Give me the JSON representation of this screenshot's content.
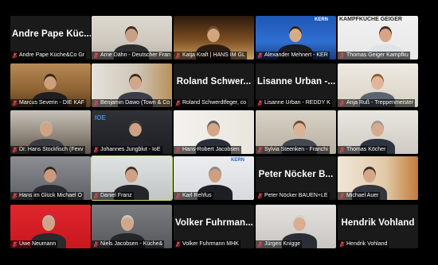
{
  "meeting": {
    "participants": [
      {
        "label": "Andre Pape Küche&Co Gr",
        "avatar_text": "Andre Pape Küc...",
        "video": false
      },
      {
        "label": "Arne Dähn - Deutscher Fran",
        "video": true
      },
      {
        "label": "Katja Kraft | HANS IM GL",
        "video": true
      },
      {
        "label": "Alexander Mehnert - KER",
        "video": true,
        "logo": "KERN"
      },
      {
        "label": "Thomas Geiger Kampfku",
        "video": true,
        "logo": "KAMPFKÜCHE GEIGER"
      },
      {
        "label": "Marcus Severin - DIE KAF",
        "video": true
      },
      {
        "label": "Benjamin Dawo (Town & Co",
        "video": true
      },
      {
        "label": "Roland Schwerdtfeger, co",
        "avatar_text": "Roland Schwer...",
        "video": false
      },
      {
        "label": "Lisanne Urban - REDDY K",
        "avatar_text": "Lisanne Urban -...",
        "video": false
      },
      {
        "label": "Anja Ruß - Treppenmeister",
        "video": true
      },
      {
        "label": "Dr. Hans Stockfisch (Fexv",
        "video": true
      },
      {
        "label": "Johannes Jungblut - IoE",
        "video": true,
        "logo": "IOE"
      },
      {
        "label": "Hans-Robert Jacobsen",
        "video": true
      },
      {
        "label": "Sylvia Steenken - Franchi",
        "video": true
      },
      {
        "label": "Thomas Köcher",
        "video": true
      },
      {
        "label": "Hans im Glück Michael O",
        "video": true
      },
      {
        "label": "Daniel Franz",
        "video": true,
        "speaking": true
      },
      {
        "label": "Karl Rehfus",
        "video": true,
        "logo": "KERN"
      },
      {
        "label": "Peter Nöcker BAUEN+LE",
        "avatar_text": "Peter Nöcker B...",
        "video": false
      },
      {
        "label": "Michael Auer",
        "video": true
      },
      {
        "label": "Uwe Neumann",
        "video": true
      },
      {
        "label": "Niels Jacobsen - Küche&",
        "video": true
      },
      {
        "label": "Volker Fuhrmann MHK",
        "avatar_text": "Volker Fuhrman...",
        "video": false
      },
      {
        "label": "Jürgen Knigge",
        "video": true
      },
      {
        "label": "Hendrik Vohland",
        "avatar_text": "Hendrik Vohland",
        "video": false
      }
    ]
  },
  "colors": {
    "background": "#000000",
    "mic_muted": "#e0464e",
    "active_speaker_border": "#c8e07a",
    "name_text": "#ffffff"
  },
  "icons": {
    "mic": "muted-microphone"
  }
}
